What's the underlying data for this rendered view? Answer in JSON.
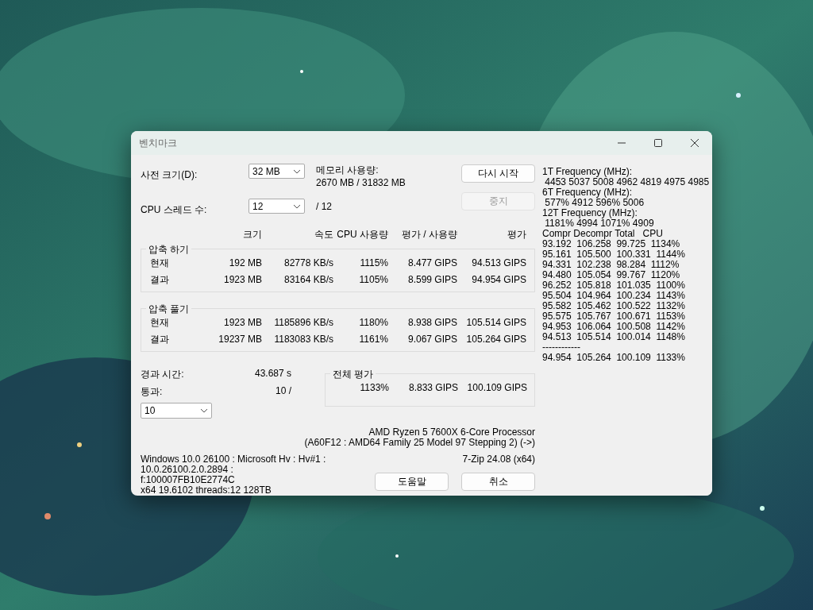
{
  "window": {
    "title": "벤치마크"
  },
  "dictionary": {
    "label": "사전 크기(D):",
    "value": "32 MB"
  },
  "memory": {
    "label": "메모리 사용량:",
    "value": "2670 MB / 31832 MB"
  },
  "threads": {
    "label": "CPU 스레드 수:",
    "value": "12",
    "total": "/ 12"
  },
  "buttons": [
    {
      "label": "다시 시작",
      "disabled": false
    },
    {
      "label": "중지",
      "disabled": true
    }
  ],
  "columns": [
    "크기",
    "속도",
    "CPU 사용량",
    "평가 / 사용량",
    "평가"
  ],
  "groups": [
    {
      "title": "압축 하기",
      "rows": [
        [
          "현재",
          "192 MB",
          "82778 KB/s",
          "1115%",
          "8.477 GIPS",
          "94.513 GIPS"
        ],
        [
          "결과",
          "1923 MB",
          "83164 KB/s",
          "1105%",
          "8.599 GIPS",
          "94.954 GIPS"
        ]
      ]
    },
    {
      "title": "압축 풀기",
      "rows": [
        [
          "현재",
          "1923 MB",
          "1185896 KB/s",
          "1180%",
          "8.938 GIPS",
          "105.514 GIPS"
        ],
        [
          "결과",
          "19237 MB",
          "1183083 KB/s",
          "1161%",
          "9.067 GIPS",
          "105.264 GIPS"
        ]
      ]
    }
  ],
  "elapsed": {
    "label": "경과 시간:",
    "value": "43.687 s"
  },
  "passes": {
    "label": "통과:",
    "value": "10 /",
    "select": "10"
  },
  "total": {
    "title": "전체 평가",
    "values": [
      "1133%",
      "8.833 GIPS",
      "100.109 GIPS"
    ]
  },
  "cpu": [
    "AMD Ryzen 5 7600X 6-Core Processor",
    "(A60F12 : AMD64 Family 25 Model 97 Stepping 2) (->)"
  ],
  "sysinfo": [
    "Windows 10.0 26100 : Microsoft Hv : Hv#1 : 10.0.26100.2.0.2894 :",
    "f:100007FB10E2774C",
    "x64 19.6102 threads:12 128TB"
  ],
  "version": "7-Zip 24.08 (x64)",
  "bottom_buttons": [
    "도움말",
    "취소"
  ],
  "log": [
    "1T Frequency (MHz):",
    " 4453 5037 5008 4962 4819 4975 4985",
    "6T Frequency (MHz):",
    " 577% 4912 596% 5006",
    "12T Frequency (MHz):",
    " 1181% 4994 1071% 4909",
    "Compr Decompr Total   CPU",
    "93.192  106.258  99.725  1134%",
    "95.161  105.500  100.331  1144%",
    "94.331  102.238  98.284  1112%",
    "94.480  105.054  99.767  1120%",
    "96.252  105.818  101.035  1100%",
    "95.504  104.964  100.234  1143%",
    "95.582  105.462  100.522  1132%",
    "95.575  105.767  100.671  1153%",
    "94.953  106.064  100.508  1142%",
    "94.513  105.514  100.014  1148%",
    "------------",
    "94.954  105.264  100.109  1133%"
  ]
}
